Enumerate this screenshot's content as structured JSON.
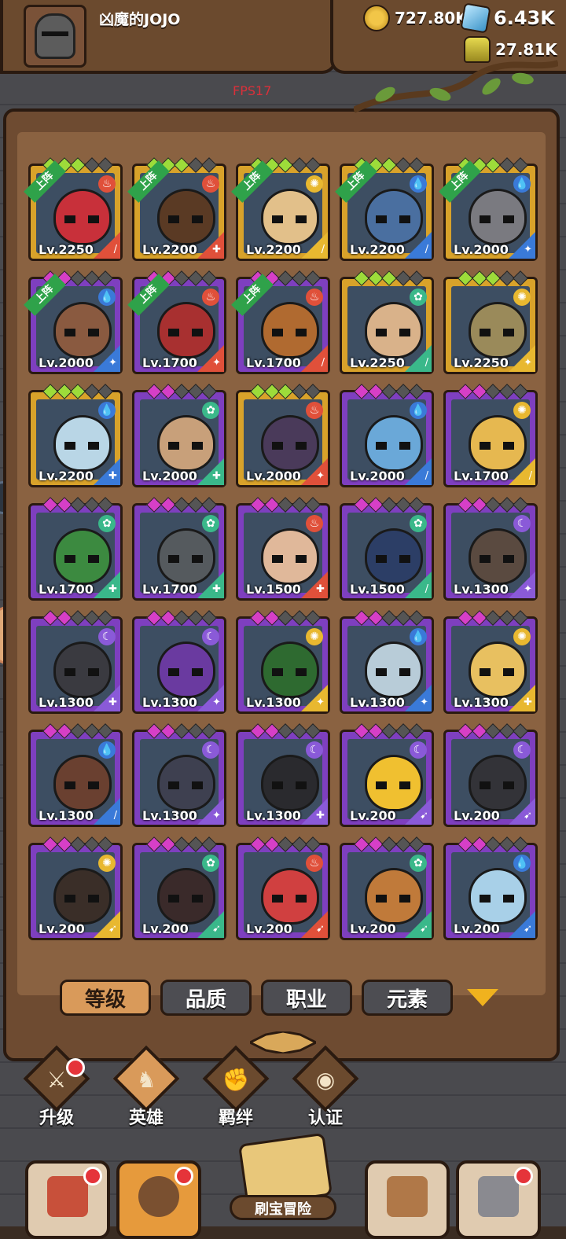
{
  "player": {
    "name": "凶魔的JOJO",
    "avatar": "knight-helmet"
  },
  "resources": {
    "gold": "727.80K",
    "gems": "6.43K",
    "potion": "27.81K"
  },
  "fps": "FPS17",
  "colors": {
    "gold_frame": "#d8a22a",
    "purple_frame": "#7e3fbf",
    "panel": "#6e4b31",
    "active_tab": "#d99a5a",
    "notify": "#e5343a"
  },
  "heroes": [
    {
      "level": "Lv.2250",
      "frame": "gold",
      "deployed": true,
      "element": "fire",
      "cls": "sword",
      "head": "#c8303a"
    },
    {
      "level": "Lv.2200",
      "frame": "gold",
      "deployed": true,
      "element": "fire",
      "cls": "shield",
      "head": "#5a3a24"
    },
    {
      "level": "Lv.2200",
      "frame": "gold",
      "deployed": true,
      "element": "light",
      "cls": "sword",
      "head": "#e2c08a"
    },
    {
      "level": "Lv.2200",
      "frame": "gold",
      "deployed": true,
      "element": "water",
      "cls": "sword",
      "head": "#4a6fa0"
    },
    {
      "level": "Lv.2000",
      "frame": "gold",
      "deployed": true,
      "element": "water",
      "cls": "staff",
      "head": "#7a7a80"
    },
    {
      "level": "Lv.2000",
      "frame": "purple",
      "deployed": true,
      "element": "water",
      "cls": "staff",
      "head": "#8a5a40"
    },
    {
      "level": "Lv.1700",
      "frame": "purple",
      "deployed": true,
      "element": "fire",
      "cls": "staff",
      "head": "#a83030"
    },
    {
      "level": "Lv.1700",
      "frame": "purple",
      "deployed": true,
      "element": "fire",
      "cls": "sword",
      "head": "#b06a30"
    },
    {
      "level": "Lv.2250",
      "frame": "gold",
      "deployed": false,
      "element": "wind",
      "cls": "sword",
      "head": "#d9b28a"
    },
    {
      "level": "Lv.2250",
      "frame": "gold",
      "deployed": false,
      "element": "light",
      "cls": "staff",
      "head": "#9a8a5a"
    },
    {
      "level": "Lv.2200",
      "frame": "gold",
      "deployed": false,
      "element": "water",
      "cls": "shield",
      "head": "#b9d6e6"
    },
    {
      "level": "Lv.2000",
      "frame": "purple",
      "deployed": false,
      "element": "wind",
      "cls": "shield",
      "head": "#c8a07a"
    },
    {
      "level": "Lv.2000",
      "frame": "gold",
      "deployed": false,
      "element": "fire",
      "cls": "staff",
      "head": "#4a3a5a"
    },
    {
      "level": "Lv.2000",
      "frame": "purple",
      "deployed": false,
      "element": "water",
      "cls": "sword",
      "head": "#6aa8d8"
    },
    {
      "level": "Lv.1700",
      "frame": "purple",
      "deployed": false,
      "element": "light",
      "cls": "sword",
      "head": "#e6b850"
    },
    {
      "level": "Lv.1700",
      "frame": "purple",
      "deployed": false,
      "element": "wind",
      "cls": "shield",
      "head": "#3c8a40"
    },
    {
      "level": "Lv.1700",
      "frame": "purple",
      "deployed": false,
      "element": "wind",
      "cls": "shield",
      "head": "#555a5e"
    },
    {
      "level": "Lv.1500",
      "frame": "purple",
      "deployed": false,
      "element": "fire",
      "cls": "shield",
      "head": "#e0b89a"
    },
    {
      "level": "Lv.1500",
      "frame": "purple",
      "deployed": false,
      "element": "wind",
      "cls": "sword",
      "head": "#2c3e66"
    },
    {
      "level": "Lv.1300",
      "frame": "purple",
      "deployed": false,
      "element": "dark",
      "cls": "staff",
      "head": "#5a4a40"
    },
    {
      "level": "Lv.1300",
      "frame": "purple",
      "deployed": false,
      "element": "dark",
      "cls": "shield",
      "head": "#3a3a40"
    },
    {
      "level": "Lv.1300",
      "frame": "purple",
      "deployed": false,
      "element": "dark",
      "cls": "staff",
      "head": "#6a3aa0"
    },
    {
      "level": "Lv.1300",
      "frame": "purple",
      "deployed": false,
      "element": "light",
      "cls": "staff",
      "head": "#2e6a30"
    },
    {
      "level": "Lv.1300",
      "frame": "purple",
      "deployed": false,
      "element": "water",
      "cls": "staff",
      "head": "#b8ccd8"
    },
    {
      "level": "Lv.1300",
      "frame": "purple",
      "deployed": false,
      "element": "light",
      "cls": "shield",
      "head": "#e8c060"
    },
    {
      "level": "Lv.1300",
      "frame": "purple",
      "deployed": false,
      "element": "water",
      "cls": "sword",
      "head": "#6a4030"
    },
    {
      "level": "Lv.1300",
      "frame": "purple",
      "deployed": false,
      "element": "dark",
      "cls": "staff",
      "head": "#3e4050"
    },
    {
      "level": "Lv.1300",
      "frame": "purple",
      "deployed": false,
      "element": "dark",
      "cls": "shield",
      "head": "#2a2a2e"
    },
    {
      "level": "Lv.200",
      "frame": "purple",
      "deployed": false,
      "element": "dark",
      "cls": "bow",
      "head": "#f0c030"
    },
    {
      "level": "Lv.200",
      "frame": "purple",
      "deployed": false,
      "element": "dark",
      "cls": "bow",
      "head": "#333338"
    },
    {
      "level": "Lv.200",
      "frame": "purple",
      "deployed": false,
      "element": "light",
      "cls": "bow",
      "head": "#3a2e28"
    },
    {
      "level": "Lv.200",
      "frame": "purple",
      "deployed": false,
      "element": "wind",
      "cls": "bow",
      "head": "#3a2a2a"
    },
    {
      "level": "Lv.200",
      "frame": "purple",
      "deployed": false,
      "element": "fire",
      "cls": "bow",
      "head": "#d04040"
    },
    {
      "level": "Lv.200",
      "frame": "purple",
      "deployed": false,
      "element": "wind",
      "cls": "bow",
      "head": "#c07a3a"
    },
    {
      "level": "Lv.200",
      "frame": "purple",
      "deployed": false,
      "element": "water",
      "cls": "bow",
      "head": "#a8d0e8"
    }
  ],
  "deployed_label": "上阵",
  "filters": {
    "level": "等级",
    "quality": "品质",
    "class": "职业",
    "element": "元素"
  },
  "subnav": {
    "upgrade": "升级",
    "hero": "英雄",
    "bond": "羁绊",
    "certify": "认证"
  },
  "bottomnav": {
    "adventure": "刷宝冒险"
  }
}
